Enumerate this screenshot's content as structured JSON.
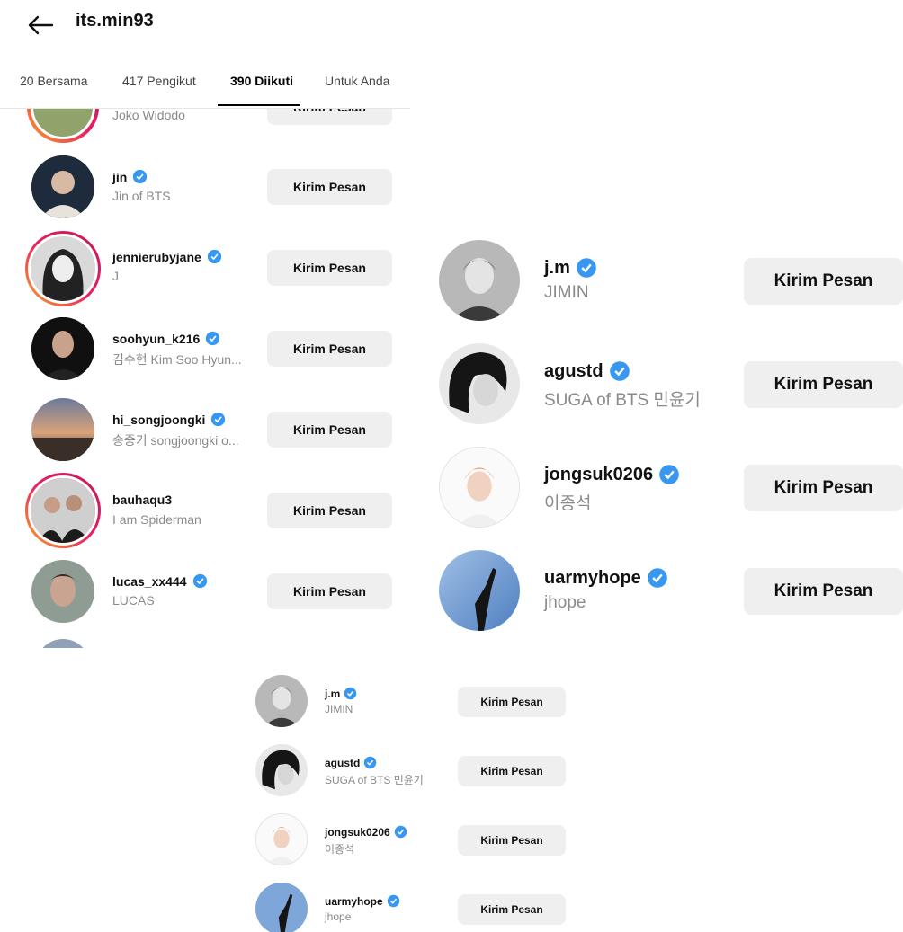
{
  "header": {
    "title": "its.min93",
    "back_icon": "arrow-left-icon"
  },
  "tabs": [
    {
      "label": "20 Bersama",
      "active": false
    },
    {
      "label": "417 Pengikut",
      "active": false
    },
    {
      "label": "390 Diikuti",
      "active": true
    },
    {
      "label": "Untuk Anda",
      "active": false
    }
  ],
  "list": {
    "partial_top": {
      "name": "Joko Widodo",
      "button": "Kirim Pesan"
    },
    "items": [
      {
        "username": "jin",
        "subtitle": "Jin of BTS",
        "verified": true,
        "story_ring": false,
        "button": "Kirim Pesan"
      },
      {
        "username": "jennierubyjane",
        "subtitle": "J",
        "verified": true,
        "story_ring": true,
        "button": "Kirim Pesan"
      },
      {
        "username": "soohyun_k216",
        "subtitle": "김수현 Kim Soo Hyun...",
        "verified": true,
        "story_ring": false,
        "button": "Kirim Pesan"
      },
      {
        "username": "hi_songjoongki",
        "subtitle": "송중기 songjoongki o...",
        "verified": true,
        "story_ring": false,
        "button": "Kirim Pesan"
      },
      {
        "username": "bauhaqu3",
        "subtitle": "I am Spiderman",
        "verified": false,
        "story_ring": true,
        "button": "Kirim Pesan"
      },
      {
        "username": "lucas_xx444",
        "subtitle": "LUCAS",
        "verified": true,
        "story_ring": false,
        "button": "Kirim Pesan"
      }
    ]
  },
  "zoom_panel": {
    "items": [
      {
        "username": "j.m",
        "subtitle": "JIMIN",
        "verified": true,
        "button": "Kirim Pesan"
      },
      {
        "username": "agustd",
        "subtitle": "SUGA of BTS 민윤기",
        "verified": true,
        "button": "Kirim Pesan"
      },
      {
        "username": "jongsuk0206",
        "subtitle": "이종석",
        "verified": true,
        "button": "Kirim Pesan"
      },
      {
        "username": "uarmyhope",
        "subtitle": "jhope",
        "verified": true,
        "button": "Kirim Pesan"
      }
    ]
  },
  "small_panel": {
    "items": [
      {
        "username": "j.m",
        "subtitle": "JIMIN",
        "verified": true,
        "button": "Kirim Pesan"
      },
      {
        "username": "agustd",
        "subtitle": "SUGA of BTS 민윤기",
        "verified": true,
        "button": "Kirim Pesan"
      },
      {
        "username": "jongsuk0206",
        "subtitle": "이종석",
        "verified": true,
        "button": "Kirim Pesan"
      },
      {
        "username": "uarmyhope",
        "subtitle": "jhope",
        "verified": true,
        "button": "Kirim Pesan"
      }
    ]
  },
  "colors": {
    "verified_blue": "#3897f0",
    "button_bg": "#efeff0",
    "story_ring_start": "#f9a825",
    "story_ring_end": "#c2185b"
  }
}
